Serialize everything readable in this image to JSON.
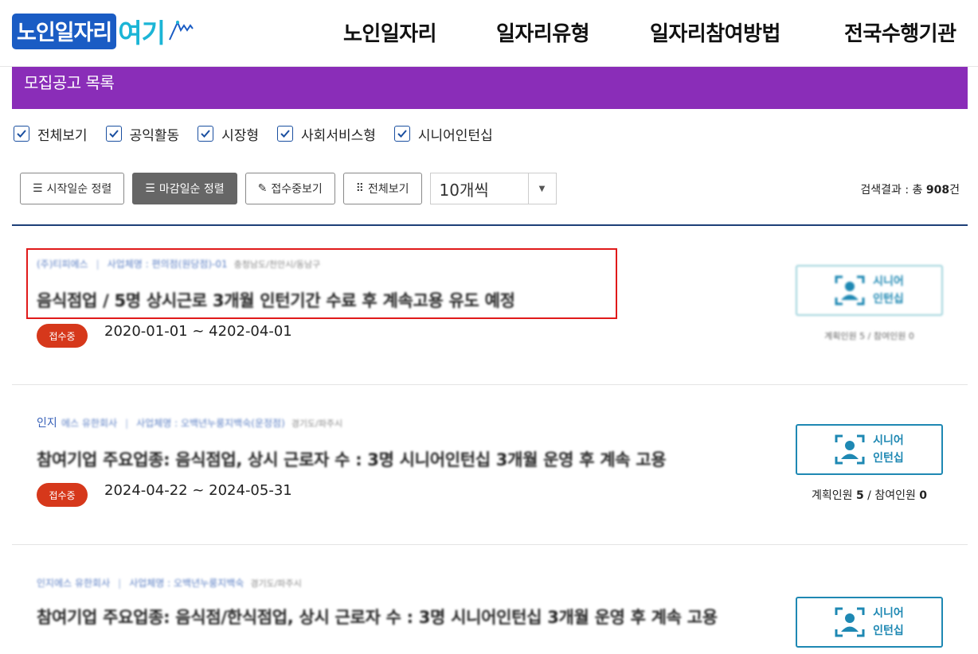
{
  "header": {
    "logo_main": "노인일자리",
    "logo_accent": "여기",
    "nav": [
      {
        "label": "노인일자리"
      },
      {
        "label": "일자리유형"
      },
      {
        "label": "일자리참여방법"
      },
      {
        "label": "전국수행기관"
      }
    ]
  },
  "banner": {
    "title": "모집공고 목록"
  },
  "filters": [
    {
      "label": "전체보기",
      "checked": true
    },
    {
      "label": "공익활동",
      "checked": true
    },
    {
      "label": "시장형",
      "checked": true
    },
    {
      "label": "사회서비스형",
      "checked": true
    },
    {
      "label": "시니어인턴십",
      "checked": true
    }
  ],
  "toolbar": {
    "sort_start": "시작일순 정렬",
    "sort_end": "마감일순 정렬",
    "receiving": "접수중보기",
    "view_all": "전체보기",
    "page_size": "10개씩"
  },
  "result": {
    "prefix": "검색결과 : 총 ",
    "count": "908",
    "suffix": "건"
  },
  "jobs": [
    {
      "company": "(주)티피에스",
      "business": "사업체명 : 편의점(원당점)-01",
      "region": "충청남도/천안시/동남구",
      "title": "음식점업 / 5명 상시근로 3개월 인턴기간 수료 후 계속고용 유도 예정",
      "status": "접수중",
      "period": "2020-01-01 ~ 4202-04-01",
      "type_line1": "시니어",
      "type_line2": "인턴십",
      "people_text": "계획인원 5 / 참여인원 0"
    },
    {
      "company_clear": "인지",
      "company": "에스 유한회사",
      "business": "사업체명 : 오백년누룽지백숙(운정점)",
      "region": "경기도/파주시",
      "title": "참여기업 주요업종: 음식점업, 상시 근로자 수 : 3명 시니어인턴십 3개월 운영 후 계속 고용",
      "status": "접수중",
      "period": "2024-04-22 ~ 2024-05-31",
      "type_line1": "시니어",
      "type_line2": "인턴십",
      "plan_label": "계획인원",
      "plan": "5",
      "join_label": "참여인원",
      "join": "0"
    },
    {
      "company": "인지에스 유한회사",
      "business": "사업체명 : 오백년누룽지백숙",
      "region": "경기도/파주시",
      "title": "참여기업 주요업종: 음식점/한식점업, 상시 근로자 수 : 3명 시니어인턴십 3개월 운영 후 계속 고용",
      "type_line1": "시니어",
      "type_line2": "인턴십"
    }
  ],
  "colors": {
    "brand_blue": "#1a5cc4",
    "brand_cyan": "#1bb5d6",
    "banner_purple": "#8a2db8",
    "status_red": "#d6381b",
    "type_border": "#1e88b3",
    "highlight_red": "#e01a1a"
  },
  "icons": [
    "check-icon",
    "list-icon",
    "pencil-icon",
    "grid-icon",
    "caret-down-icon",
    "person-frame-icon"
  ]
}
